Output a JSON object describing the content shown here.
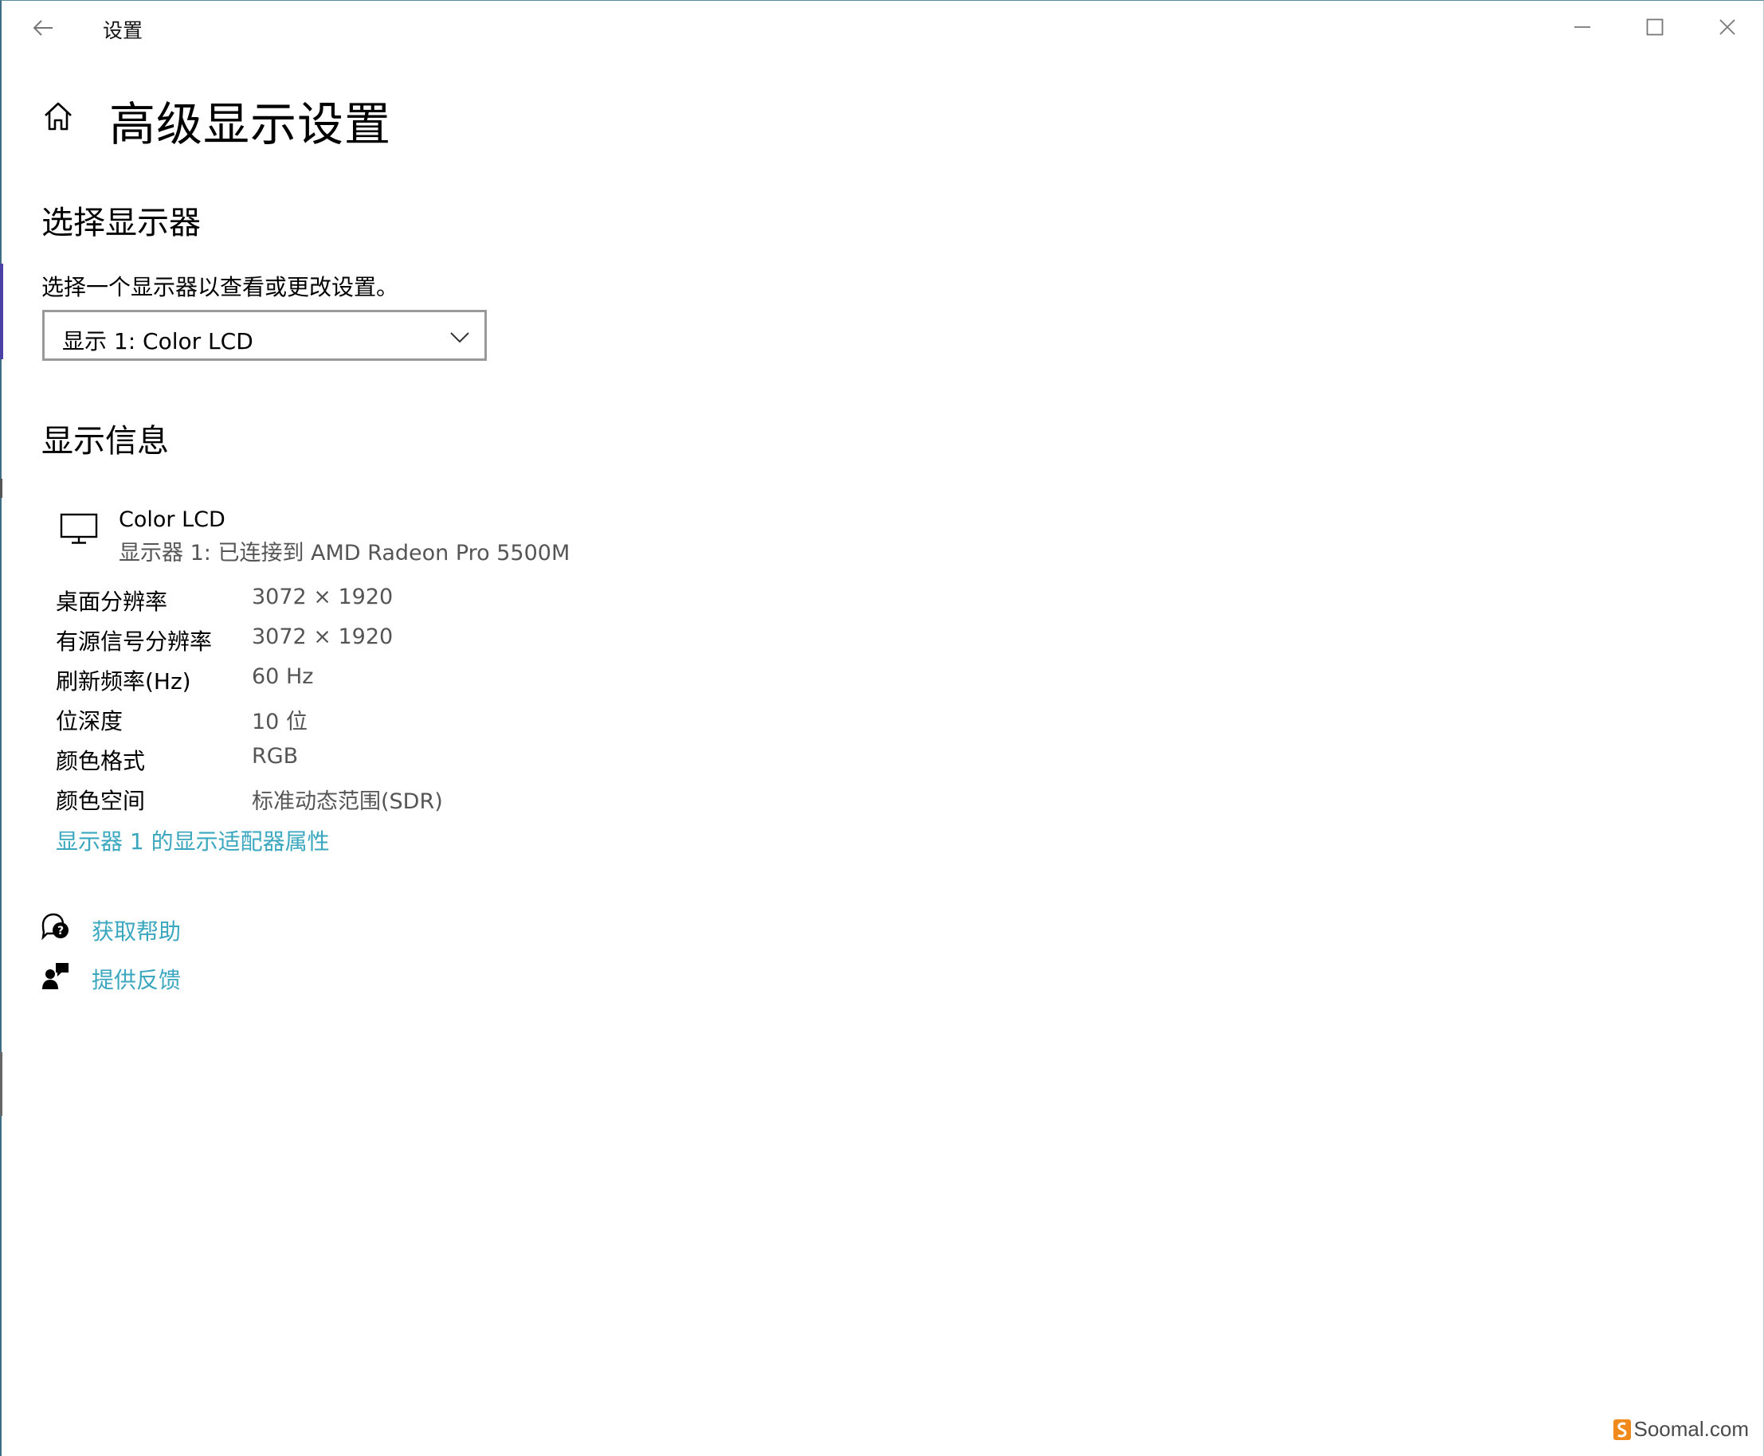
{
  "window": {
    "app_title": "设置",
    "back_icon": "back-arrow-icon",
    "controls": {
      "minimize_icon": "minimize-icon",
      "maximize_icon": "maximize-icon",
      "close_icon": "close-icon"
    }
  },
  "header": {
    "home_icon": "home-icon",
    "title": "高级显示设置"
  },
  "select_display": {
    "heading": "选择显示器",
    "description": "选择一个显示器以查看或更改设置。",
    "dropdown_value": "显示 1: Color LCD"
  },
  "display_info": {
    "heading": "显示信息",
    "monitor_name": "Color LCD",
    "monitor_subtitle": "显示器 1: 已连接到 AMD Radeon Pro 5500M",
    "rows": [
      {
        "label": "桌面分辨率",
        "value": "3072 × 1920"
      },
      {
        "label": "有源信号分辨率",
        "value": "3072 × 1920"
      },
      {
        "label": "刷新频率(Hz)",
        "value": "60 Hz"
      },
      {
        "label": "位深度",
        "value": "10 位"
      },
      {
        "label": "颜色格式",
        "value": "RGB"
      },
      {
        "label": "颜色空间",
        "value": "标准动态范围(SDR)"
      }
    ],
    "adapter_link": "显示器 1 的显示适配器属性"
  },
  "support": {
    "help_link": "获取帮助",
    "feedback_link": "提供反馈"
  },
  "watermark": {
    "text": "Soomal.com"
  },
  "colors": {
    "link": "#3aa7bf",
    "secondary_text": "#555555",
    "dropdown_border": "#999999"
  }
}
